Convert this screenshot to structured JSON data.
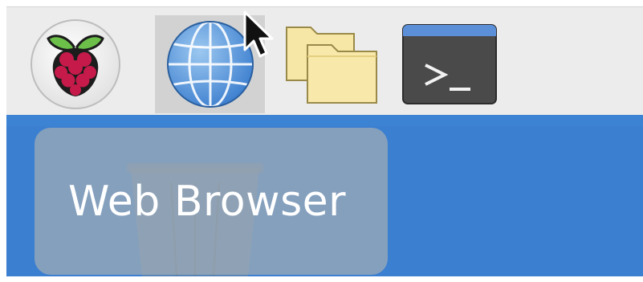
{
  "taskbar": {
    "launchers": [
      {
        "id": "menu",
        "icon": "raspberry-pi-icon"
      },
      {
        "id": "browser",
        "icon": "globe-icon",
        "state": "hover"
      },
      {
        "id": "files",
        "icon": "folders-icon"
      },
      {
        "id": "terminal",
        "icon": "terminal-icon"
      }
    ]
  },
  "tooltip": {
    "text": "Web Browser"
  },
  "desktop": {
    "background_color": "#3a7fd0",
    "items": [
      {
        "icon": "trash-icon"
      }
    ]
  }
}
